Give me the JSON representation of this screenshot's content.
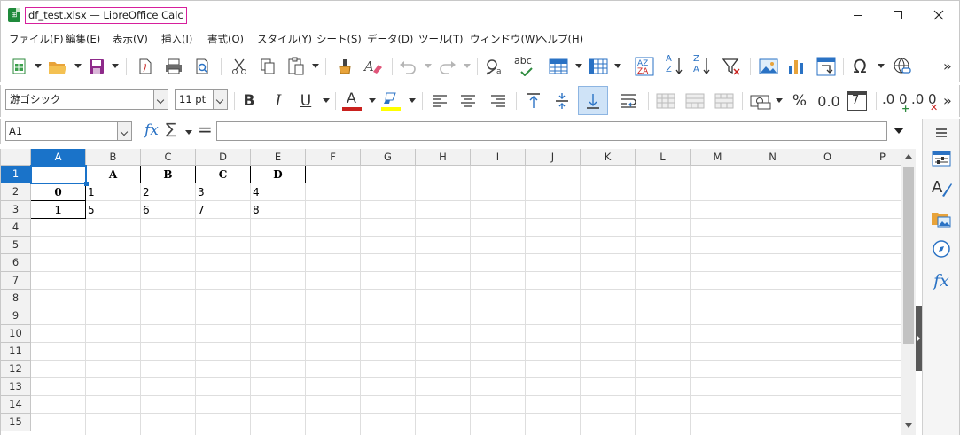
{
  "window": {
    "title": "df_test.xlsx — LibreOffice Calc",
    "app_icon_name": "calc-app-icon"
  },
  "menu": [
    "ファイル(F)",
    "編集(E)",
    "表示(V)",
    "挿入(I)",
    "書式(O)",
    "スタイル(Y)",
    "シート(S)",
    "データ(D)",
    "ツール(T)",
    "ウィンドウ(W)",
    "ヘルプ(H)"
  ],
  "toolbar_standard": {
    "icons": [
      "new-icon",
      "open-icon",
      "save-icon",
      "export-pdf-icon",
      "print-icon",
      "print-preview-icon",
      "cut-icon",
      "copy-icon",
      "paste-icon",
      "clone-formatting-icon",
      "clear-formatting-icon",
      "undo-icon",
      "redo-icon",
      "find-replace-icon",
      "spelling-icon",
      "row-icon",
      "column-icon",
      "sort-icon",
      "sort-ascending-icon",
      "sort-descending-icon",
      "autofilter-icon",
      "image-icon",
      "chart-icon",
      "pivot-table-icon",
      "special-character-icon",
      "hyperlink-icon"
    ],
    "spelling_label": "abc",
    "sort_labels": [
      "A",
      "Z"
    ],
    "more": "»"
  },
  "toolbar_formatting": {
    "font_name": "游ゴシック",
    "font_size": "11 pt",
    "bold": "B",
    "italic": "I",
    "underline": "U",
    "font_color_letter": "A",
    "font_color": "#c9211e",
    "highlight_color": "#ffff00",
    "percent": "%",
    "number_format": "0.0",
    "add_decimal": ".0",
    "add_decimal_suffix": "0",
    "remove_decimal": ".0",
    "remove_decimal_suffix": "0",
    "date_day": "7"
  },
  "formula_bar": {
    "name_box": "A1",
    "fx": "fx",
    "sigma": "∑",
    "equals": "=",
    "content": ""
  },
  "sheet": {
    "columns": [
      "A",
      "B",
      "C",
      "D",
      "E",
      "F",
      "G",
      "H",
      "I",
      "J",
      "K",
      "L",
      "M",
      "N",
      "O",
      "P"
    ],
    "rows": [
      "1",
      "2",
      "3",
      "4",
      "5",
      "6",
      "7",
      "8",
      "9",
      "10",
      "11",
      "12",
      "13",
      "14",
      "15"
    ],
    "selected_cell": "A1",
    "header_row": [
      "",
      "A",
      "B",
      "C",
      "D"
    ],
    "data_rows": [
      {
        "index": "0",
        "values": [
          "1",
          "2",
          "3",
          "4"
        ]
      },
      {
        "index": "1",
        "values": [
          "5",
          "6",
          "7",
          "8"
        ]
      }
    ]
  },
  "sidebar": {
    "icons": [
      "properties-icon",
      "styles-icon",
      "gallery-icon",
      "navigator-icon",
      "functions-icon"
    ],
    "functions_label": "fx"
  },
  "colors": {
    "selection": "#1a73c9",
    "accent_blue": "#2a72c4",
    "calc_green": "#1f8a3b",
    "title_highlight": "#d61f9c"
  }
}
